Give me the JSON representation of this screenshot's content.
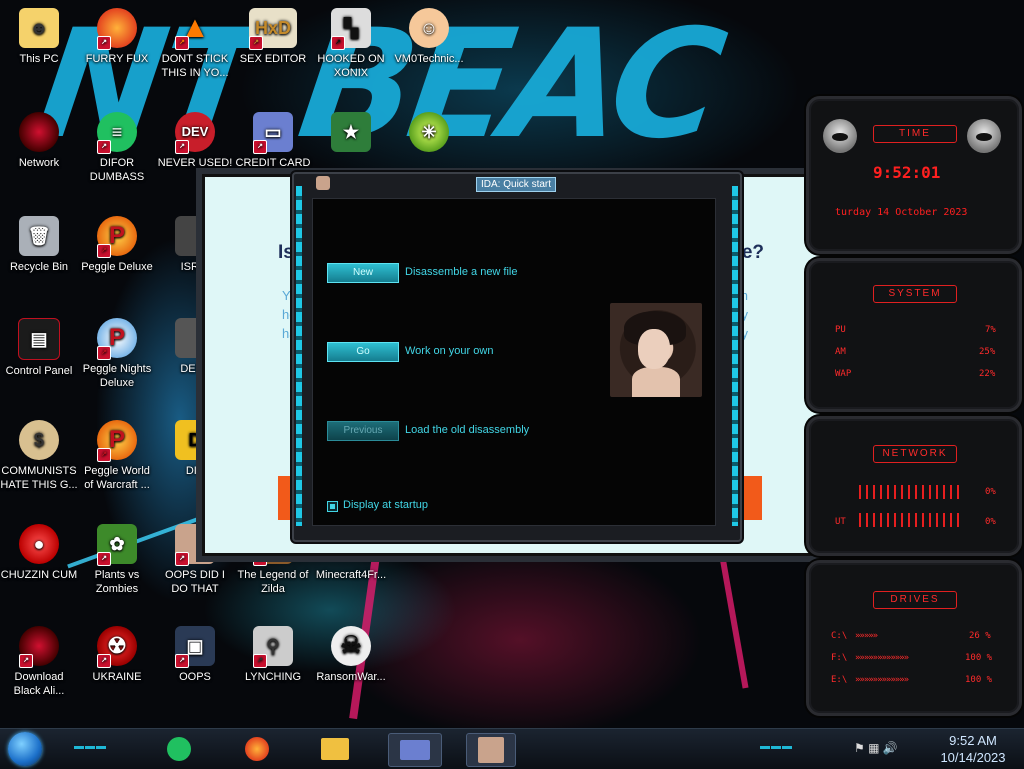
{
  "desktop": {
    "icons": [
      {
        "label": "This PC"
      },
      {
        "label": "FURRY FUX"
      },
      {
        "label": "DONT STICK THIS IN YO..."
      },
      {
        "label": "SEX EDITOR"
      },
      {
        "label": "HOOKED ON XONIX"
      },
      {
        "label": "VM0Technic..."
      },
      {
        "label": "Network"
      },
      {
        "label": "DIFOR DUMBASS"
      },
      {
        "label": "NEVER USED!"
      },
      {
        "label": "CREDIT CARD"
      },
      {
        "label": "Recycle Bin"
      },
      {
        "label": "Peggle Deluxe"
      },
      {
        "label": "ISRAI"
      },
      {
        "label": "Control Panel"
      },
      {
        "label": "Peggle Nights Deluxe"
      },
      {
        "label": "DEEZ"
      },
      {
        "label": "COMMUNISTS HATE THIS G..."
      },
      {
        "label": "Peggle World of Warcraft ..."
      },
      {
        "label": "DIE"
      },
      {
        "label": "CHUZZIN CUM"
      },
      {
        "label": "Plants vs Zombies"
      },
      {
        "label": "OOPS DID I DO THAT"
      },
      {
        "label": "The Legend of Zilda"
      },
      {
        "label": "Minecraft4Fr..."
      },
      {
        "label": "Download Black Ali..."
      },
      {
        "label": "UKRAINE"
      },
      {
        "label": "OOPS"
      },
      {
        "label": "LYNCHING"
      },
      {
        "label": "RansomWar..."
      }
    ],
    "wallpaper_text": "NT BEAC"
  },
  "background_window": {
    "heading_left": "Is",
    "heading_right": "se?",
    "para_left": "Yo\nhe\nhav",
    "para_right": "on\nny\ny"
  },
  "ida_dialog": {
    "title": "IDA: Quick start",
    "options": [
      {
        "button": "New",
        "label": "Disassemble a new file",
        "enabled": true
      },
      {
        "button": "Go",
        "label": "Work on your own",
        "enabled": true
      },
      {
        "button": "Previous",
        "label": "Load the old disassembly",
        "enabled": false
      }
    ],
    "display_at_startup": {
      "label": "Display at startup",
      "checked": true
    }
  },
  "gadgets": {
    "time": {
      "title": "TIME",
      "clock": "9:52:01",
      "date": "turday 14 October 2023"
    },
    "system": {
      "title": "SYSTEM",
      "rows": [
        {
          "label": "PU",
          "value": "7%"
        },
        {
          "label": "AM",
          "value": "25%"
        },
        {
          "label": "WAP",
          "value": "22%"
        }
      ]
    },
    "network": {
      "title": "NETWORK",
      "rows": [
        {
          "label": "",
          "value": "0%"
        },
        {
          "label": "UT",
          "value": "0%"
        }
      ]
    },
    "drives": {
      "title": "DRIVES",
      "rows": [
        {
          "label": "C:\\",
          "value": "26 %"
        },
        {
          "label": "F:\\",
          "value": "100 %"
        },
        {
          "label": "E:\\",
          "value": "100 %"
        }
      ]
    }
  },
  "taskbar": {
    "apps": [
      {
        "icon": "green-chat-app-icon"
      },
      {
        "icon": "firefox-icon"
      },
      {
        "icon": "file-explorer-icon"
      },
      {
        "icon": "credit-card-app-icon",
        "active": true
      },
      {
        "icon": "ida-portrait-icon",
        "active": true
      }
    ],
    "time": "9:52 AM",
    "date": "10/14/2023"
  },
  "colors": {
    "accent_cyan": "#42d6e6",
    "gadget_red": "#ff2020",
    "orange": "#f25a1a"
  }
}
